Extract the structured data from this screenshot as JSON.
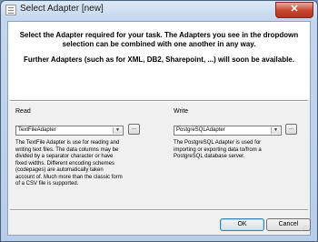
{
  "window": {
    "title": "Select Adapter [new]",
    "close_glyph": "✕",
    "icon": "app-window-icon"
  },
  "header": {
    "line1": "Select the Adapter required for your task. The Adapters you see in the dropdown selection can be combined with one another in any way.",
    "line2": "Further Adapters (such as for XML, DB2, Sharepoint, ...) will soon be available."
  },
  "read": {
    "label": "Read",
    "selected": "TextFileAdapter",
    "browse_label": "...",
    "description": "The TextFile Adapter is use for reading and writing text files. The data columns may be divided by a separator character or have fixed widths. Different encoding schemes (codepages) are automatically taken account of. Much more than the classic form of a CSV file is supported."
  },
  "write": {
    "label": "Write",
    "selected": "PostgreSQLAdapter",
    "browse_label": "...",
    "description": "The PostgreSQL Adapter is used for importing or exporting data to/from a PostgreSQL database server."
  },
  "buttons": {
    "ok": "OK",
    "cancel": "Cancel"
  },
  "colors": {
    "title_bar": "#c3d6ee",
    "close_button": "#c8442f",
    "header_background": "#ffffff",
    "client_background": "#f0f0f0"
  }
}
